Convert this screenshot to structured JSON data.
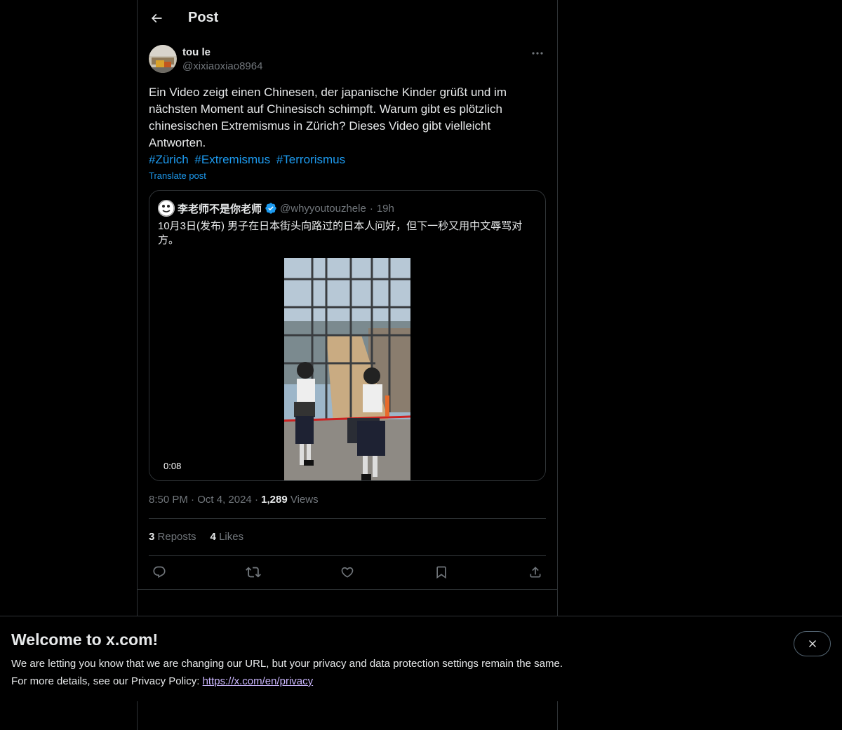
{
  "header": {
    "title": "Post",
    "back_icon": "arrow-left-icon"
  },
  "post": {
    "author_name": "tou le",
    "author_handle": "@xixiaoxiao8964",
    "text": "Ein Video zeigt einen Chinesen, der japanische Kinder grüßt und im nächsten Moment auf Chinesisch schimpft. Warum gibt es plötzlich chinesischen Extremismus in Zürich? Dieses Video gibt vielleicht Antworten.",
    "hashtags": [
      "#Zürich",
      "#Extremismus",
      "#Terrorismus"
    ],
    "translate_label": "Translate post",
    "time": "8:50 PM",
    "date": "Oct 4, 2024",
    "views_count": "1,289",
    "views_label": "Views",
    "reposts_count": "3",
    "reposts_label": "Reposts",
    "likes_count": "4",
    "likes_label": "Likes"
  },
  "quote": {
    "name": "李老师不是你老师",
    "handle": "@whyyoutouzhele",
    "time": "19h",
    "text": "10月3日(发布) 男子在日本街头向路过的日本人问好，但下一秒又用中文辱骂对方。",
    "video_duration": "0:08"
  },
  "actions": [
    "reply-icon",
    "repost-icon",
    "like-icon",
    "bookmark-icon",
    "share-icon"
  ],
  "banner": {
    "title": "Welcome to x.com!",
    "line1": "We are letting you know that we are changing our URL, but your privacy and data protection settings remain the same.",
    "line2_prefix": "For more details, see our Privacy Policy: ",
    "link": "https://x.com/en/privacy"
  },
  "colors": {
    "accent": "#1d9bf0",
    "text": "#e7e9ea",
    "muted": "#71767b",
    "border": "#2f3336",
    "link_visited": "#ccb8ff"
  }
}
